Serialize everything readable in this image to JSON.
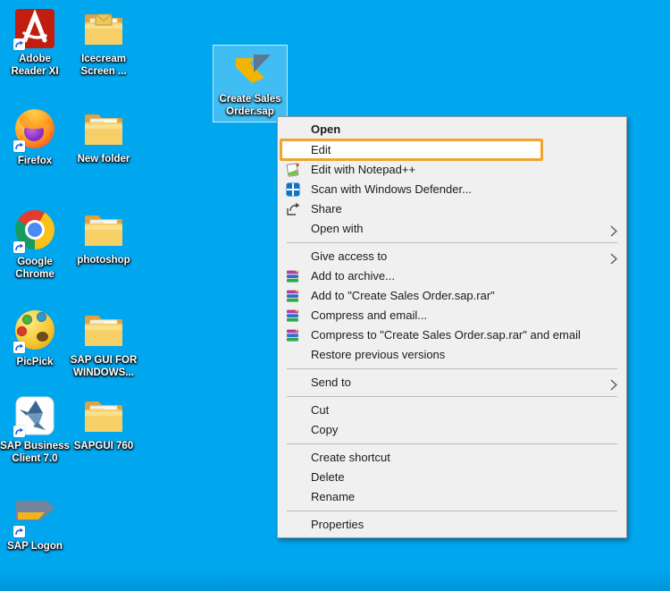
{
  "desktop": {
    "background_color": "#00a7ef",
    "icons": [
      {
        "name": "adobe-reader",
        "label": "Adobe\nReader XI",
        "icon": "adobe-reader-icon",
        "shortcut": true
      },
      {
        "name": "icecream-screen",
        "label": "Icecream\nScreen ...",
        "icon": "folder-envelope-icon",
        "shortcut": false
      },
      {
        "name": "firefox",
        "label": "Firefox",
        "icon": "firefox-icon",
        "shortcut": true
      },
      {
        "name": "new-folder",
        "label": "New folder",
        "icon": "folder-icon",
        "shortcut": false
      },
      {
        "name": "google-chrome",
        "label": "Google\nChrome",
        "icon": "chrome-icon",
        "shortcut": true
      },
      {
        "name": "photoshop",
        "label": "photoshop",
        "icon": "folder-icon",
        "shortcut": false
      },
      {
        "name": "picpick",
        "label": "PicPick",
        "icon": "picpick-palette-icon",
        "shortcut": true
      },
      {
        "name": "sap-gui-for-windows",
        "label": "SAP GUI FOR\nWINDOWS...",
        "icon": "folder-icon",
        "shortcut": false
      },
      {
        "name": "sap-business-client",
        "label": "SAP Business\nClient 7.0",
        "icon": "hummingbird-icon",
        "shortcut": true
      },
      {
        "name": "sapgui-760",
        "label": "SAPGUI 760",
        "icon": "folder-icon",
        "shortcut": false
      },
      {
        "name": "sap-logon",
        "label": "SAP Logon",
        "icon": "sap-logon-icon",
        "shortcut": true
      }
    ],
    "selected_file": {
      "name": "create-sales-order",
      "label": "Create Sales\nOrder.sap",
      "icon": "sap-shortcut-file-icon",
      "selected": true
    }
  },
  "context_menu": {
    "items": [
      {
        "label": "Open",
        "bold": true
      },
      {
        "label": "Edit",
        "highlighted": true
      },
      {
        "label": "Edit with Notepad++",
        "icon": "notepadpp-icon"
      },
      {
        "label": "Scan with Windows Defender...",
        "icon": "windows-defender-icon"
      },
      {
        "label": "Share",
        "icon": "share-icon"
      },
      {
        "label": "Open with",
        "submenu": true
      },
      {
        "label": "Give access to",
        "submenu": true
      },
      {
        "label": "Add to archive...",
        "icon": "winrar-icon"
      },
      {
        "label": "Add to \"Create Sales Order.sap.rar\"",
        "icon": "winrar-icon"
      },
      {
        "label": "Compress and email...",
        "icon": "winrar-icon"
      },
      {
        "label": "Compress to \"Create Sales Order.sap.rar\" and email",
        "icon": "winrar-icon"
      },
      {
        "label": "Restore previous versions"
      },
      {
        "label": "Send to",
        "submenu": true
      },
      {
        "label": "Cut"
      },
      {
        "label": "Copy"
      },
      {
        "label": "Create shortcut"
      },
      {
        "label": "Delete"
      },
      {
        "label": "Rename"
      },
      {
        "label": "Properties"
      }
    ]
  },
  "annotation": {
    "highlighted_item": "Edit",
    "highlight_color": "#f0a330"
  }
}
